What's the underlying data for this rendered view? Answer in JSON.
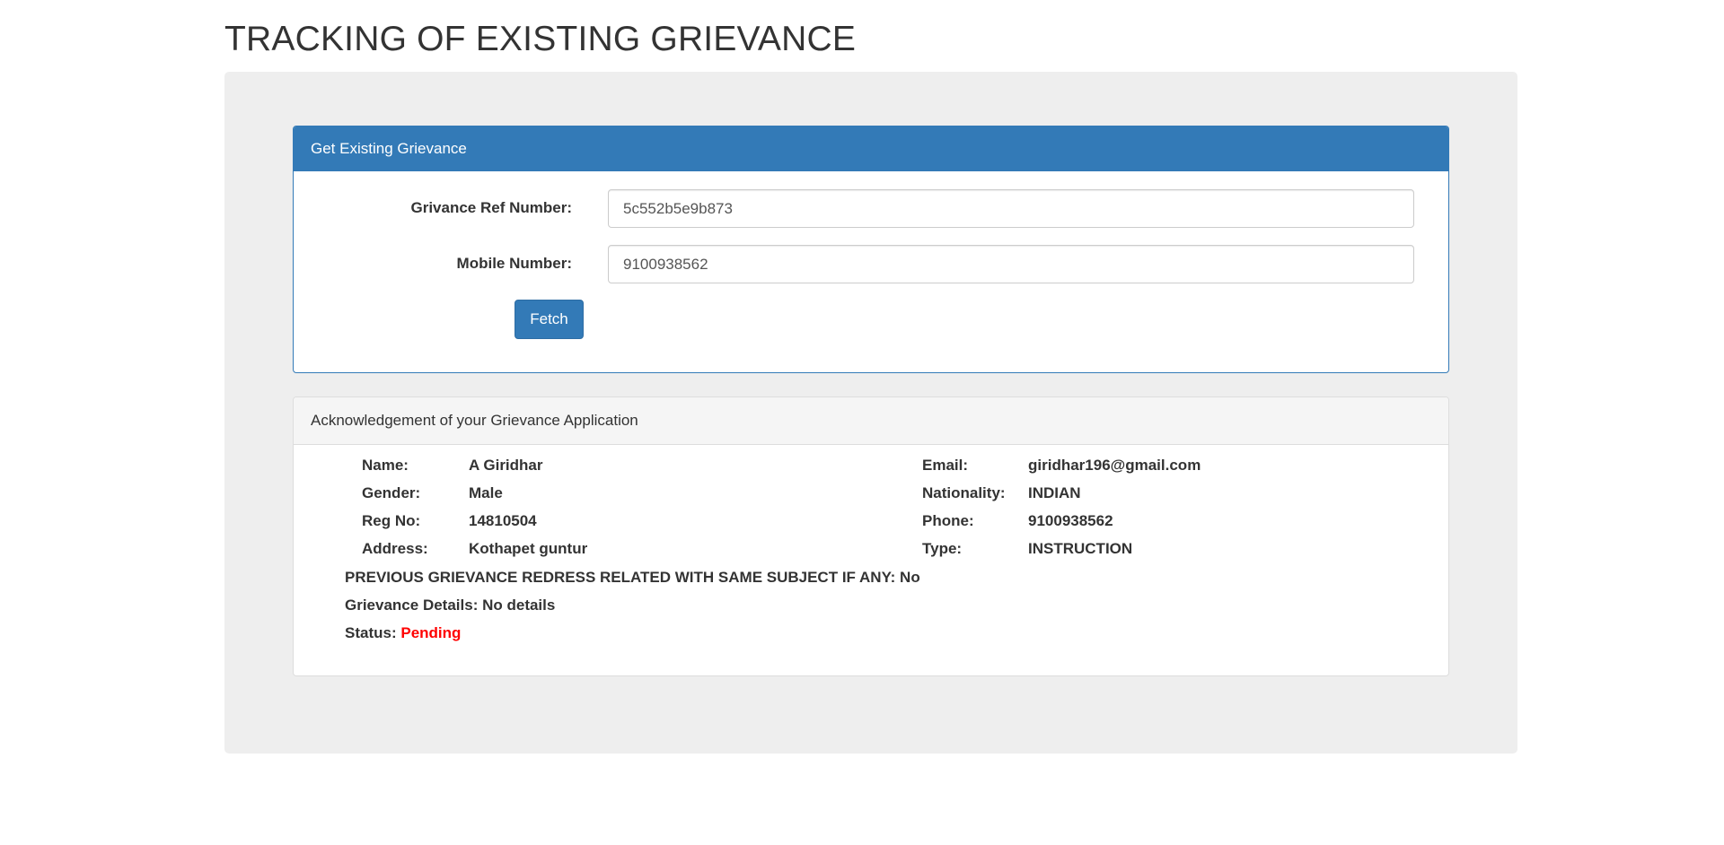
{
  "page": {
    "title": "TRACKING OF EXISTING GRIEVANCE"
  },
  "form_panel": {
    "heading": "Get Existing Grievance",
    "ref_label": "Grivance Ref Number:",
    "ref_value": "5c552b5e9b873",
    "mobile_label": "Mobile Number:",
    "mobile_value": "9100938562",
    "fetch_button": "Fetch"
  },
  "ack_panel": {
    "heading": "Acknowledgement of your Grievance Application",
    "left": [
      {
        "label": "Name:",
        "value": "A Giridhar"
      },
      {
        "label": "Gender:",
        "value": "Male"
      },
      {
        "label": "Reg No:",
        "value": "14810504"
      },
      {
        "label": "Address:",
        "value": "Kothapet guntur"
      }
    ],
    "right": [
      {
        "label": "Email:",
        "value": "giridhar196@gmail.com"
      },
      {
        "label": "Nationality:",
        "value": "INDIAN"
      },
      {
        "label": "Phone:",
        "value": "9100938562"
      },
      {
        "label": "Type:",
        "value": "INSTRUCTION"
      }
    ],
    "previous_label": "PREVIOUS GRIEVANCE REDRESS RELATED WITH SAME SUBJECT IF ANY:",
    "previous_value": "No",
    "details_label": "Grievance Details:",
    "details_value": "No details",
    "status_label": "Status:",
    "status_value": "Pending",
    "status_color": "#ff0000"
  },
  "colors": {
    "primary": "#337ab7",
    "well_bg": "#eeeeee"
  }
}
